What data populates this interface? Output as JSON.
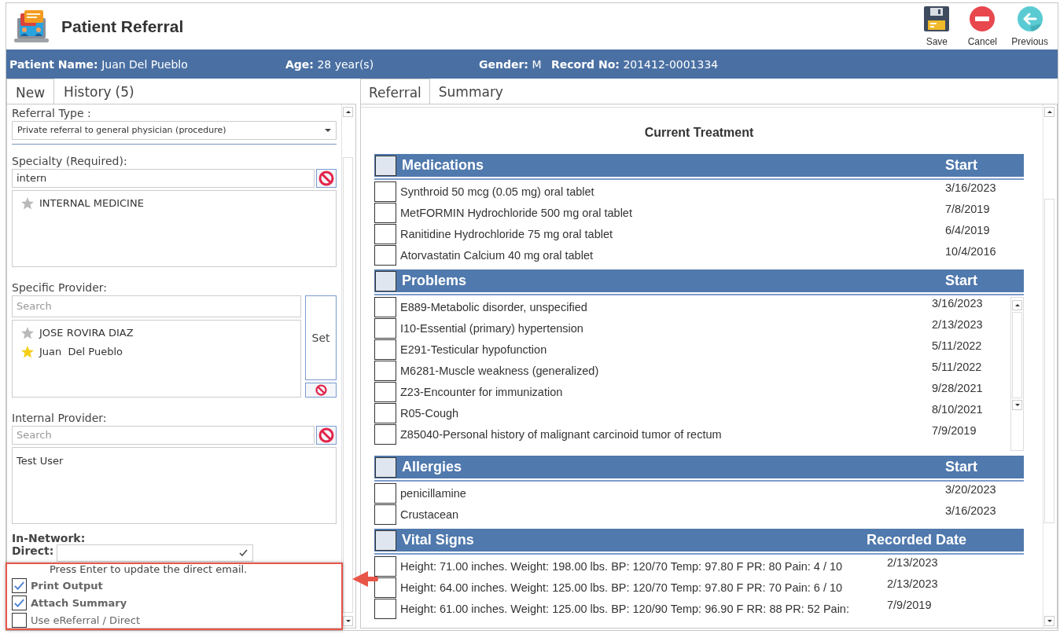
{
  "window": {
    "title": "Patient Referral"
  },
  "toolbar": [
    {
      "label": "Save",
      "kind": "save"
    },
    {
      "label": "Cancel",
      "kind": "cancel"
    },
    {
      "label": "Previous",
      "kind": "previous"
    }
  ],
  "patient": [
    {
      "label": "Patient Name:",
      "value": "Juan Del Pueblo"
    },
    {
      "label": "Age:",
      "value": "28 year(s)"
    },
    {
      "label": "Gender:",
      "value": "M"
    },
    {
      "label": "Record No:",
      "value": "201412-0001334"
    }
  ],
  "left_tabs": [
    {
      "label": "New",
      "selected": true
    },
    {
      "label": "History",
      "count": "(5)",
      "selected": false
    }
  ],
  "referral_type": {
    "label": "Referral Type :",
    "value": "Private referral to general physician (procedure)"
  },
  "specialty": {
    "label": "Specialty (Required):",
    "value": "intern",
    "results": [
      {
        "name": "INTERNAL MEDICINE",
        "favorite": false
      }
    ]
  },
  "specific_provider": {
    "label": "Specific Provider:",
    "placeholder": "Search",
    "set_button": "Set",
    "results": [
      {
        "name": "JOSE ROVIRA DIAZ",
        "favorite": false
      },
      {
        "name": "Juan  Del Pueblo",
        "favorite": true
      }
    ]
  },
  "internal_provider": {
    "label": "Internal Provider:",
    "placeholder": "Search",
    "results": [
      "Test User"
    ]
  },
  "in_network": {
    "label": "In-Network:"
  },
  "direct": {
    "label": "Direct:",
    "hint": "Press Enter to update the direct email."
  },
  "options": [
    {
      "label": "Print Output",
      "checked": true
    },
    {
      "label": "Attach Summary",
      "checked": true
    },
    {
      "label": "Use eReferral / Direct",
      "checked": false
    }
  ],
  "right_tabs": [
    {
      "label": "Referral",
      "selected": true
    },
    {
      "label": "Summary",
      "selected": false
    }
  ],
  "treatment_title": "Current Treatment",
  "sections": [
    {
      "title": "Medications",
      "date_heading": "Start",
      "checked": false,
      "scrollable": false,
      "rows": [
        {
          "text": "Synthroid 50 mcg (0.05 mg) oral tablet",
          "date": "3/16/2023",
          "checked": false
        },
        {
          "text": "MetFORMIN Hydrochloride 500 mg oral tablet",
          "date": "7/8/2019",
          "checked": false
        },
        {
          "text": "Ranitidine Hydrochloride 75 mg oral tablet",
          "date": "6/4/2019",
          "checked": false
        },
        {
          "text": "Atorvastatin Calcium 40 mg oral tablet",
          "date": "10/4/2016",
          "checked": false
        }
      ]
    },
    {
      "title": "Problems",
      "date_heading": "Start",
      "checked": false,
      "scrollable": true,
      "rows": [
        {
          "text": "E889-Metabolic disorder, unspecified",
          "date": "3/16/2023",
          "checked": false
        },
        {
          "text": "I10-Essential (primary) hypertension",
          "date": "2/13/2023",
          "checked": false
        },
        {
          "text": "E291-Testicular hypofunction",
          "date": "5/11/2022",
          "checked": false
        },
        {
          "text": "M6281-Muscle weakness (generalized)",
          "date": "5/11/2022",
          "checked": false
        },
        {
          "text": "Z23-Encounter for immunization",
          "date": "9/28/2021",
          "checked": false
        },
        {
          "text": "R05-Cough",
          "date": "8/10/2021",
          "checked": false
        },
        {
          "text": "Z85040-Personal history of malignant carcinoid tumor of rectum",
          "date": "7/9/2019",
          "checked": false
        }
      ]
    },
    {
      "title": "Allergies",
      "date_heading": "Start",
      "checked": false,
      "scrollable": false,
      "rows": [
        {
          "text": "penicillamine",
          "date": "3/20/2023",
          "checked": false
        },
        {
          "text": "Crustacean",
          "date": "3/16/2023",
          "checked": false
        }
      ]
    },
    {
      "title": "Vital Signs",
      "date_heading": "Recorded Date",
      "checked": false,
      "scrollable": false,
      "rows": [
        {
          "text": "Height: 71.00 inches. Weight: 198.00 lbs. BP: 120/70 Temp: 97.80 F PR: 80 Pain: 4 / 10",
          "date": "2/13/2023",
          "checked": false
        },
        {
          "text": "Height: 64.00 inches. Weight: 125.00 lbs. BP: 120/70 Temp: 97.80 F PR: 70 Pain: 6 / 10",
          "date": "2/13/2023",
          "checked": false
        },
        {
          "text": "Height: 61.00 inches. Weight: 125.00 lbs. BP: 120/90 Temp: 96.90 F RR: 88 PR: 52 Pain:",
          "date": "7/9/2019",
          "checked": false
        }
      ]
    }
  ]
}
